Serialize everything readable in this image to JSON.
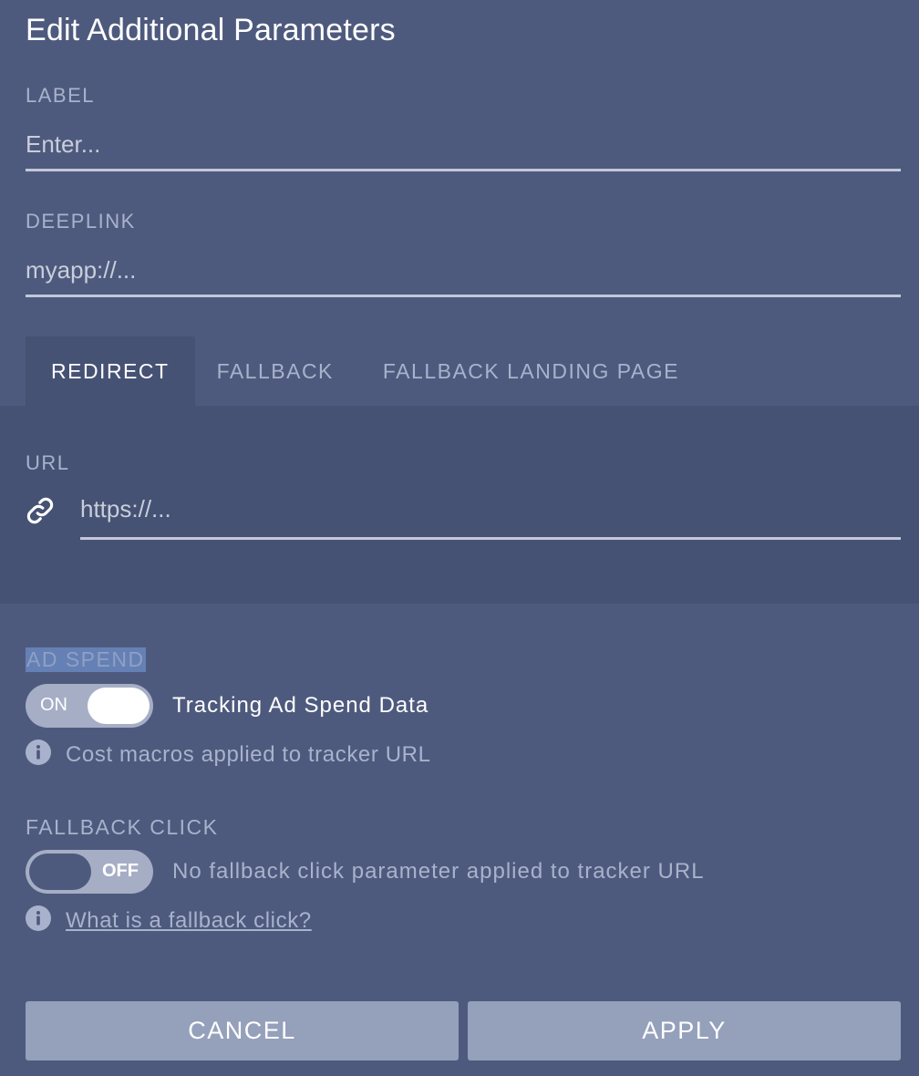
{
  "dialog": {
    "title": "Edit Additional Parameters"
  },
  "label_field": {
    "label": "LABEL",
    "placeholder": "Enter..."
  },
  "deeplink_field": {
    "label": "DEEPLINK",
    "placeholder": "myapp://..."
  },
  "tabs": [
    {
      "label": "REDIRECT",
      "active": true
    },
    {
      "label": "FALLBACK",
      "active": false
    },
    {
      "label": "FALLBACK LANDING PAGE",
      "active": false
    }
  ],
  "url_field": {
    "label": "URL",
    "placeholder": "https://...",
    "icon": "link-icon"
  },
  "ad_spend": {
    "label": "AD SPEND",
    "toggle_state": "ON",
    "toggle_on": true,
    "description": "Tracking Ad Spend Data",
    "info": "Cost macros applied to tracker URL"
  },
  "fallback_click": {
    "label": "FALLBACK CLICK",
    "toggle_state": "OFF",
    "toggle_on": false,
    "description": "No fallback click parameter applied to tracker URL",
    "info_link": "What is a fallback click?"
  },
  "buttons": {
    "cancel": "CANCEL",
    "apply": "APPLY"
  },
  "colors": {
    "background": "#4e5a7d",
    "panel": "#465274",
    "button": "#95a0bb",
    "muted_text": "#a9b2cc"
  }
}
